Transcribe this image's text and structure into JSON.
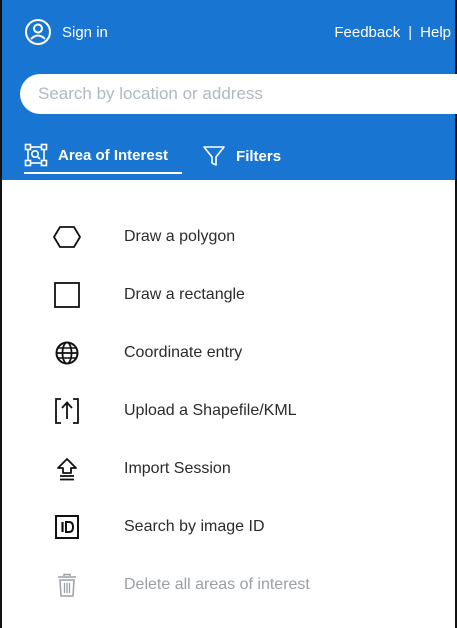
{
  "header": {
    "sign_in_label": "Sign in",
    "feedback_label": "Feedback",
    "separator": "|",
    "help_label": "Help"
  },
  "search": {
    "placeholder": "Search by location or address",
    "value": ""
  },
  "tabs": [
    {
      "label": "Area of Interest",
      "icon": "area-of-interest-icon",
      "active": true
    },
    {
      "label": "Filters",
      "icon": "filter-icon",
      "active": false
    }
  ],
  "menu": [
    {
      "label": "Draw a polygon",
      "icon": "polygon-icon",
      "enabled": true
    },
    {
      "label": "Draw a rectangle",
      "icon": "rectangle-icon",
      "enabled": true
    },
    {
      "label": "Coordinate entry",
      "icon": "globe-icon",
      "enabled": true
    },
    {
      "label": "Upload a Shapefile/KML",
      "icon": "upload-icon",
      "enabled": true
    },
    {
      "label": "Import Session",
      "icon": "import-icon",
      "enabled": true
    },
    {
      "label": "Search by image ID",
      "icon": "id-icon",
      "enabled": true
    },
    {
      "label": "Delete all areas of interest",
      "icon": "trash-icon",
      "enabled": false
    }
  ],
  "colors": {
    "header_bg": "#1876d2",
    "text": "#2b2b2b",
    "disabled_text": "#9aa0a6"
  }
}
